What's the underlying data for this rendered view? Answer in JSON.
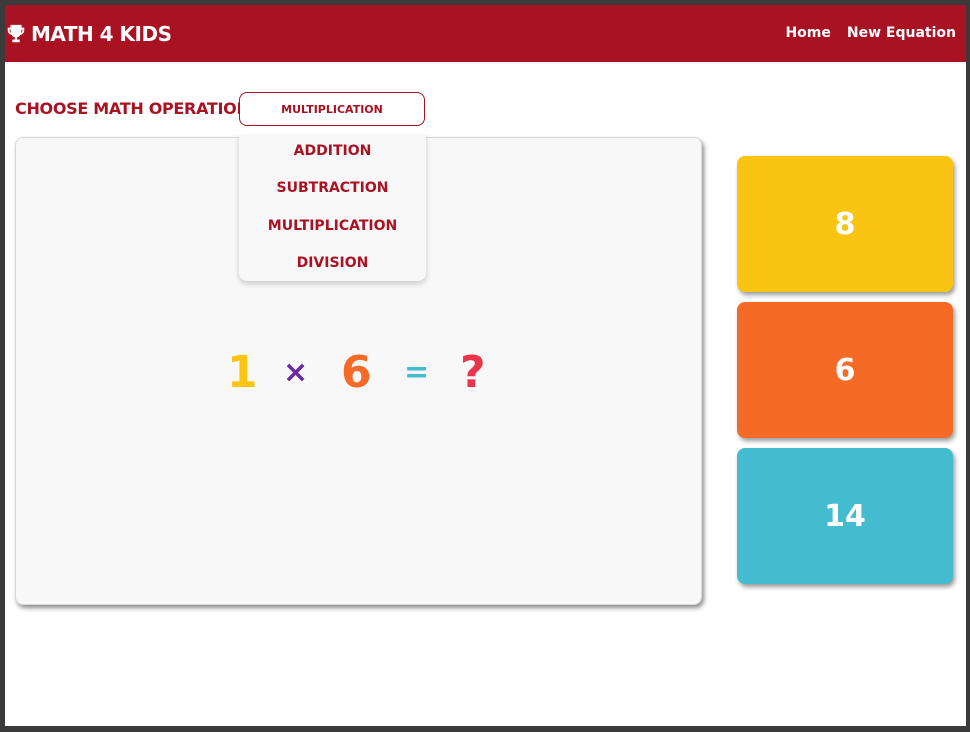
{
  "navbar": {
    "brand": "Math 4 Kids",
    "links": [
      "Home",
      "New Equation"
    ]
  },
  "operation": {
    "label": "Choose math operation:",
    "selected": "Multiplication",
    "options": [
      "Addition",
      "Subtraction",
      "Multiplication",
      "Division"
    ]
  },
  "equation": {
    "left": "1",
    "operator": "×",
    "right": "6",
    "equals": "=",
    "answer": "?"
  },
  "answers": [
    "8",
    "6",
    "14"
  ],
  "colors": {
    "brand": "#a81222",
    "yellow": "#f9c412",
    "orange": "#f66a27",
    "teal": "#45bbcf",
    "purple": "#6a2aa0",
    "red": "#e8354a"
  },
  "icons": {
    "brand": "trophy-icon"
  }
}
